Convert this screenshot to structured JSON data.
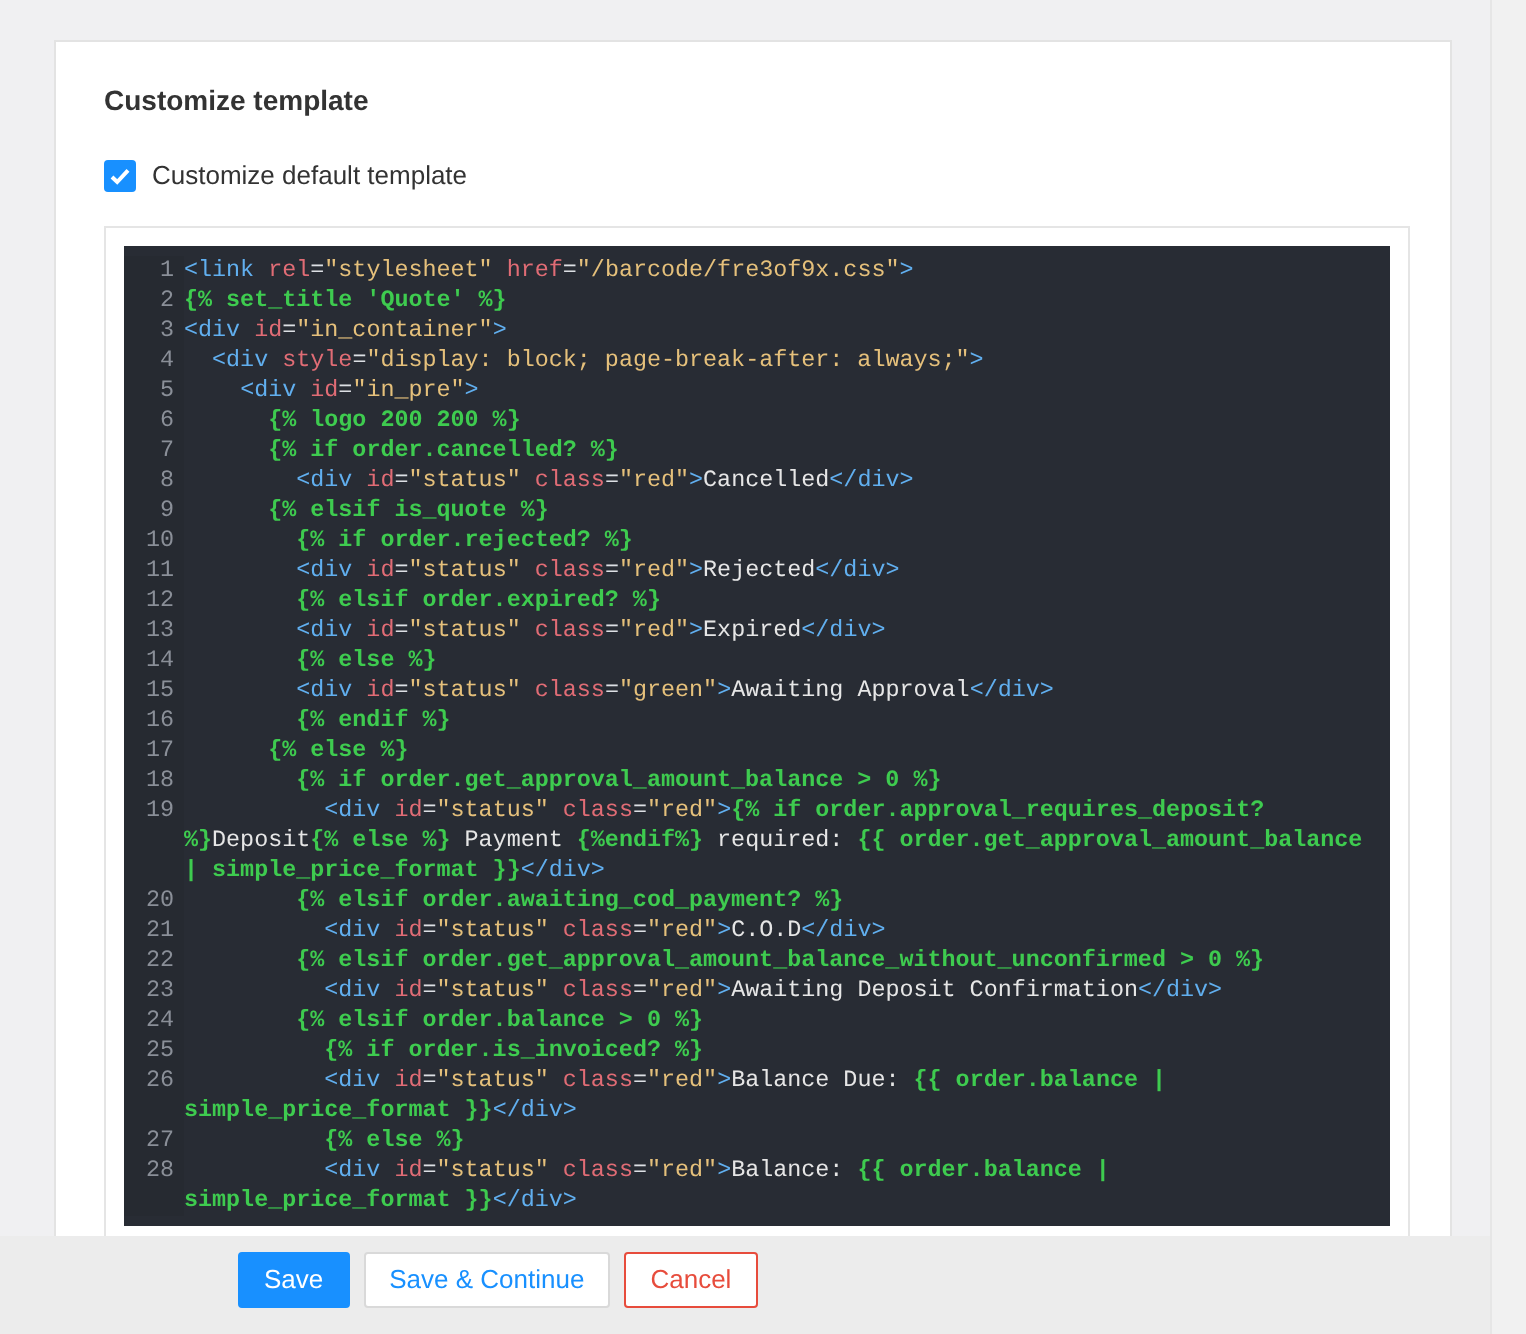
{
  "section": {
    "title": "Customize template"
  },
  "customize_checkbox": {
    "label": "Customize default template",
    "checked": true
  },
  "editor": {
    "lines": [
      {
        "number": "1",
        "tokens": [
          {
            "kind": "tag",
            "text": "<link"
          },
          {
            "kind": "attr",
            "text": " rel"
          },
          {
            "kind": "punct",
            "text": "="
          },
          {
            "kind": "str",
            "text": "\"stylesheet\""
          },
          {
            "kind": "attr",
            "text": " href"
          },
          {
            "kind": "punct",
            "text": "="
          },
          {
            "kind": "str",
            "text": "\"/barcode/fre3of9x.css\""
          },
          {
            "kind": "tag",
            "text": ">"
          }
        ]
      },
      {
        "number": "2",
        "tokens": [
          {
            "kind": "liquid",
            "text": "{% set_title 'Quote' %}"
          }
        ]
      },
      {
        "number": "3",
        "tokens": [
          {
            "kind": "tag",
            "text": "<div"
          },
          {
            "kind": "attr",
            "text": " id"
          },
          {
            "kind": "punct",
            "text": "="
          },
          {
            "kind": "str",
            "text": "\"in_container\""
          },
          {
            "kind": "tag",
            "text": ">"
          }
        ]
      },
      {
        "number": "4",
        "tokens": [
          {
            "kind": "tag",
            "text": "  <div"
          },
          {
            "kind": "attr",
            "text": " style"
          },
          {
            "kind": "punct",
            "text": "="
          },
          {
            "kind": "str",
            "text": "\"display: block; page-break-after: always;\""
          },
          {
            "kind": "tag",
            "text": ">"
          }
        ]
      },
      {
        "number": "5",
        "tokens": [
          {
            "kind": "tag",
            "text": "    <div"
          },
          {
            "kind": "attr",
            "text": " id"
          },
          {
            "kind": "punct",
            "text": "="
          },
          {
            "kind": "str",
            "text": "\"in_pre\""
          },
          {
            "kind": "tag",
            "text": ">"
          }
        ]
      },
      {
        "number": "6",
        "tokens": [
          {
            "kind": "liquid",
            "text": "      {% logo 200 200 %}"
          }
        ]
      },
      {
        "number": "7",
        "tokens": [
          {
            "kind": "liquid",
            "text": "      {% if order.cancelled? %}"
          }
        ]
      },
      {
        "number": "8",
        "tokens": [
          {
            "kind": "tag",
            "text": "        <div"
          },
          {
            "kind": "attr",
            "text": " id"
          },
          {
            "kind": "punct",
            "text": "="
          },
          {
            "kind": "str",
            "text": "\"status\""
          },
          {
            "kind": "attr",
            "text": " class"
          },
          {
            "kind": "punct",
            "text": "="
          },
          {
            "kind": "str",
            "text": "\"red\""
          },
          {
            "kind": "tag",
            "text": ">"
          },
          {
            "kind": "text",
            "text": "Cancelled"
          },
          {
            "kind": "tag",
            "text": "</div>"
          }
        ]
      },
      {
        "number": "9",
        "tokens": [
          {
            "kind": "liquid",
            "text": "      {% elsif is_quote %}"
          }
        ]
      },
      {
        "number": "10",
        "tokens": [
          {
            "kind": "liquid",
            "text": "        {% if order.rejected? %}"
          }
        ]
      },
      {
        "number": "11",
        "tokens": [
          {
            "kind": "tag",
            "text": "        <div"
          },
          {
            "kind": "attr",
            "text": " id"
          },
          {
            "kind": "punct",
            "text": "="
          },
          {
            "kind": "str",
            "text": "\"status\""
          },
          {
            "kind": "attr",
            "text": " class"
          },
          {
            "kind": "punct",
            "text": "="
          },
          {
            "kind": "str",
            "text": "\"red\""
          },
          {
            "kind": "tag",
            "text": ">"
          },
          {
            "kind": "text",
            "text": "Rejected"
          },
          {
            "kind": "tag",
            "text": "</div>"
          }
        ]
      },
      {
        "number": "12",
        "tokens": [
          {
            "kind": "liquid",
            "text": "        {% elsif order.expired? %}"
          }
        ]
      },
      {
        "number": "13",
        "tokens": [
          {
            "kind": "tag",
            "text": "        <div"
          },
          {
            "kind": "attr",
            "text": " id"
          },
          {
            "kind": "punct",
            "text": "="
          },
          {
            "kind": "str",
            "text": "\"status\""
          },
          {
            "kind": "attr",
            "text": " class"
          },
          {
            "kind": "punct",
            "text": "="
          },
          {
            "kind": "str",
            "text": "\"red\""
          },
          {
            "kind": "tag",
            "text": ">"
          },
          {
            "kind": "text",
            "text": "Expired"
          },
          {
            "kind": "tag",
            "text": "</div>"
          }
        ]
      },
      {
        "number": "14",
        "tokens": [
          {
            "kind": "liquid",
            "text": "        {% else %}"
          }
        ]
      },
      {
        "number": "15",
        "tokens": [
          {
            "kind": "tag",
            "text": "        <div"
          },
          {
            "kind": "attr",
            "text": " id"
          },
          {
            "kind": "punct",
            "text": "="
          },
          {
            "kind": "str",
            "text": "\"status\""
          },
          {
            "kind": "attr",
            "text": " class"
          },
          {
            "kind": "punct",
            "text": "="
          },
          {
            "kind": "str",
            "text": "\"green\""
          },
          {
            "kind": "tag",
            "text": ">"
          },
          {
            "kind": "text",
            "text": "Awaiting Approval"
          },
          {
            "kind": "tag",
            "text": "</div>"
          }
        ]
      },
      {
        "number": "16",
        "tokens": [
          {
            "kind": "liquid",
            "text": "        {% endif %}"
          }
        ]
      },
      {
        "number": "17",
        "tokens": [
          {
            "kind": "liquid",
            "text": "      {% else %}"
          }
        ]
      },
      {
        "number": "18",
        "tokens": [
          {
            "kind": "liquid",
            "text": "        {% if order.get_approval_amount_balance > 0 %}"
          }
        ]
      },
      {
        "number": "19",
        "tokens": [
          {
            "kind": "tag",
            "text": "          <div"
          },
          {
            "kind": "attr",
            "text": " id"
          },
          {
            "kind": "punct",
            "text": "="
          },
          {
            "kind": "str",
            "text": "\"status\""
          },
          {
            "kind": "attr",
            "text": " class"
          },
          {
            "kind": "punct",
            "text": "="
          },
          {
            "kind": "str",
            "text": "\"red\""
          },
          {
            "kind": "tag",
            "text": ">"
          },
          {
            "kind": "liquid",
            "text": "{% if order.approval_requires_deposit? %}"
          },
          {
            "kind": "text",
            "text": "Deposit"
          },
          {
            "kind": "liquid",
            "text": "{% else %}"
          },
          {
            "kind": "text",
            "text": " Payment "
          },
          {
            "kind": "liquid",
            "text": "{%endif%}"
          },
          {
            "kind": "text",
            "text": " required: "
          },
          {
            "kind": "liquid",
            "text": "{{ order.get_approval_amount_balance | simple_price_format }}"
          },
          {
            "kind": "tag",
            "text": "</div>"
          }
        ]
      },
      {
        "number": "20",
        "tokens": [
          {
            "kind": "liquid",
            "text": "        {% elsif order.awaiting_cod_payment? %}"
          }
        ]
      },
      {
        "number": "21",
        "tokens": [
          {
            "kind": "tag",
            "text": "          <div"
          },
          {
            "kind": "attr",
            "text": " id"
          },
          {
            "kind": "punct",
            "text": "="
          },
          {
            "kind": "str",
            "text": "\"status\""
          },
          {
            "kind": "attr",
            "text": " class"
          },
          {
            "kind": "punct",
            "text": "="
          },
          {
            "kind": "str",
            "text": "\"red\""
          },
          {
            "kind": "tag",
            "text": ">"
          },
          {
            "kind": "text",
            "text": "C.O.D"
          },
          {
            "kind": "tag",
            "text": "</div>"
          }
        ]
      },
      {
        "number": "22",
        "tokens": [
          {
            "kind": "liquid",
            "text": "        {% elsif order.get_approval_amount_balance_without_unconfirmed > 0 %}"
          }
        ]
      },
      {
        "number": "23",
        "tokens": [
          {
            "kind": "tag",
            "text": "          <div"
          },
          {
            "kind": "attr",
            "text": " id"
          },
          {
            "kind": "punct",
            "text": "="
          },
          {
            "kind": "str",
            "text": "\"status\""
          },
          {
            "kind": "attr",
            "text": " class"
          },
          {
            "kind": "punct",
            "text": "="
          },
          {
            "kind": "str",
            "text": "\"red\""
          },
          {
            "kind": "tag",
            "text": ">"
          },
          {
            "kind": "text",
            "text": "Awaiting Deposit Confirmation"
          },
          {
            "kind": "tag",
            "text": "</div>"
          }
        ]
      },
      {
        "number": "24",
        "tokens": [
          {
            "kind": "liquid",
            "text": "        {% elsif order.balance > 0 %}"
          }
        ]
      },
      {
        "number": "25",
        "tokens": [
          {
            "kind": "liquid",
            "text": "          {% if order.is_invoiced? %}"
          }
        ]
      },
      {
        "number": "26",
        "tokens": [
          {
            "kind": "tag",
            "text": "          <div"
          },
          {
            "kind": "attr",
            "text": " id"
          },
          {
            "kind": "punct",
            "text": "="
          },
          {
            "kind": "str",
            "text": "\"status\""
          },
          {
            "kind": "attr",
            "text": " class"
          },
          {
            "kind": "punct",
            "text": "="
          },
          {
            "kind": "str",
            "text": "\"red\""
          },
          {
            "kind": "tag",
            "text": ">"
          },
          {
            "kind": "text",
            "text": "Balance Due: "
          },
          {
            "kind": "liquid",
            "text": "{{ order.balance | simple_price_format }}"
          },
          {
            "kind": "tag",
            "text": "</div>"
          }
        ]
      },
      {
        "number": "27",
        "tokens": [
          {
            "kind": "liquid",
            "text": "          {% else %}"
          }
        ]
      },
      {
        "number": "28",
        "tokens": [
          {
            "kind": "tag",
            "text": "          <div"
          },
          {
            "kind": "attr",
            "text": " id"
          },
          {
            "kind": "punct",
            "text": "="
          },
          {
            "kind": "str",
            "text": "\"status\""
          },
          {
            "kind": "attr",
            "text": " class"
          },
          {
            "kind": "punct",
            "text": "="
          },
          {
            "kind": "str",
            "text": "\"red\""
          },
          {
            "kind": "tag",
            "text": ">"
          },
          {
            "kind": "text",
            "text": "Balance: "
          },
          {
            "kind": "liquid",
            "text": "{{ order.balance | simple_price_format }}"
          },
          {
            "kind": "tag",
            "text": "</div>"
          }
        ]
      }
    ]
  },
  "buttons": [
    {
      "kind": "primary",
      "label": "Save"
    },
    {
      "kind": "secondary",
      "label": "Save & Continue"
    },
    {
      "kind": "danger",
      "label": "Cancel"
    }
  ]
}
